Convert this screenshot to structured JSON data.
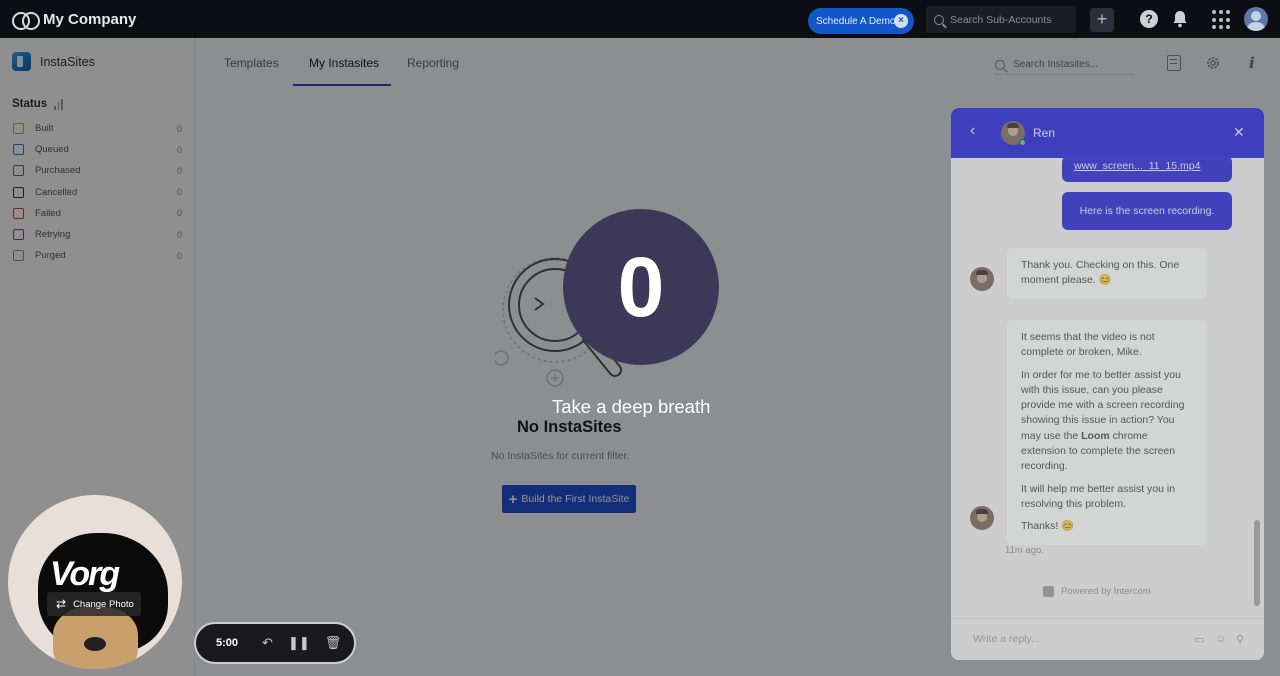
{
  "topbar": {
    "company": "My Company",
    "demo_label": "Schedule A Demo",
    "search_placeholder": "Search Sub-Accounts",
    "plus_label": "+",
    "help_label": "?"
  },
  "sidebar": {
    "app_name": "InstaSites",
    "status_label": "Status",
    "statuses": [
      {
        "label": "Built",
        "count": "0",
        "color": "#c99a3c"
      },
      {
        "label": "Queued",
        "count": "0",
        "color": "#3b6fd1"
      },
      {
        "label": "Purchased",
        "count": "0",
        "color": "#3f7a3f"
      },
      {
        "label": "Cancelled",
        "count": "0",
        "color": "#333333"
      },
      {
        "label": "Failed",
        "count": "0",
        "color": "#c9385a"
      },
      {
        "label": "Retrying",
        "count": "0",
        "color": "#7a3f8f"
      },
      {
        "label": "Purged",
        "count": "0",
        "color": "#888888"
      }
    ]
  },
  "main": {
    "tabs": [
      "Templates",
      "My Instasites",
      "Reporting"
    ],
    "active_tab": "My Instasites",
    "search_placeholder": "Search Instasites...",
    "empty_title": "No InstaSites",
    "empty_sub": "No InstaSites for current filter.",
    "build_label": "Build the First InstaSite",
    "accent": "#1f4fd1"
  },
  "chat": {
    "agent_name": "Ren",
    "link_text": "www_screen..._11_15.mp4",
    "user_msg": "Here is the screen recording.",
    "agent_msg1": "Thank you. Checking on this. One moment please. 😊",
    "agent_msg2_p1": "It seems that the video is not complete or broken, Mike.",
    "agent_msg2_p2a": "In order for me to better assist you with this issue, can you please provide me with a screen recording showing this issue in action? You may use the ",
    "agent_msg2_bold": "Loom",
    "agent_msg2_p2b": " chrome extension to complete the screen recording.",
    "agent_msg2_p3": "It will help me better assist you in resolving this problem.",
    "agent_msg2_p4": "Thanks! 😊",
    "time_ago": "11m ago.",
    "powered_by": "Powered by Intercom",
    "reply_placeholder": "Write a reply...",
    "header_color": "#0d10d9"
  },
  "overlay": {
    "countdown": "0",
    "breath_text": "Take a deep breath"
  },
  "camera": {
    "change_photo": "Change Photo",
    "scribble": "Vorg"
  },
  "recorder": {
    "time": "5:00"
  }
}
